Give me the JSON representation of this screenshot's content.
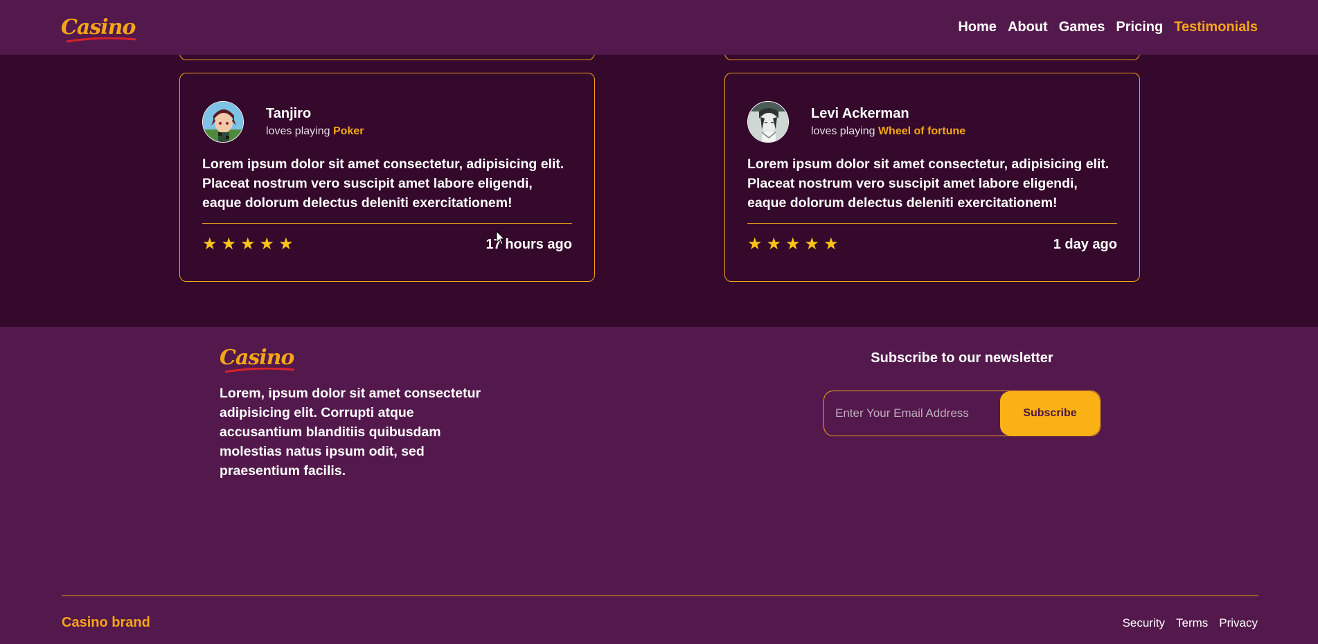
{
  "colors": {
    "accent": "#f5a617",
    "header_bg": "#53194c",
    "section_bg": "#34092b",
    "star": "#fcc419"
  },
  "header": {
    "logo_text": "Casino",
    "nav": [
      {
        "label": "Home",
        "active": false
      },
      {
        "label": "About",
        "active": false
      },
      {
        "label": "Games",
        "active": false
      },
      {
        "label": "Pricing",
        "active": false
      },
      {
        "label": "Testimonials",
        "active": true
      }
    ]
  },
  "testimonials": [
    {
      "name": "Tanjiro",
      "loves_prefix": "loves playing",
      "game": "Poker",
      "avatar_icon": "tanjiro-avatar",
      "text": "Lorem ipsum dolor sit amet consectetur, adipisicing elit. Placeat nostrum vero suscipit amet labore eligendi, eaque dolorum delectus deleniti exercitationem!",
      "rating": 5,
      "time": "17 hours ago"
    },
    {
      "name": "Levi Ackerman",
      "loves_prefix": "loves playing",
      "game": "Wheel of fortune",
      "avatar_icon": "levi-avatar",
      "text": "Lorem ipsum dolor sit amet consectetur, adipisicing elit. Placeat nostrum vero suscipit amet labore eligendi, eaque dolorum delectus deleniti exercitationem!",
      "rating": 5,
      "time": "1 day ago"
    }
  ],
  "footer": {
    "logo_text": "Casino",
    "about_text": "Lorem, ipsum dolor sit amet consectetur adipisicing elit. Corrupti atque accusantium blanditiis quibusdam molestias natus ipsum odit, sed praesentium facilis.",
    "newsletter_title": "Subscribe to our newsletter",
    "email_placeholder": "Enter Your Email Address",
    "email_value": "",
    "subscribe_label": "Subscribe",
    "brand": "Casino brand",
    "links": [
      "Security",
      "Terms",
      "Privacy"
    ]
  }
}
